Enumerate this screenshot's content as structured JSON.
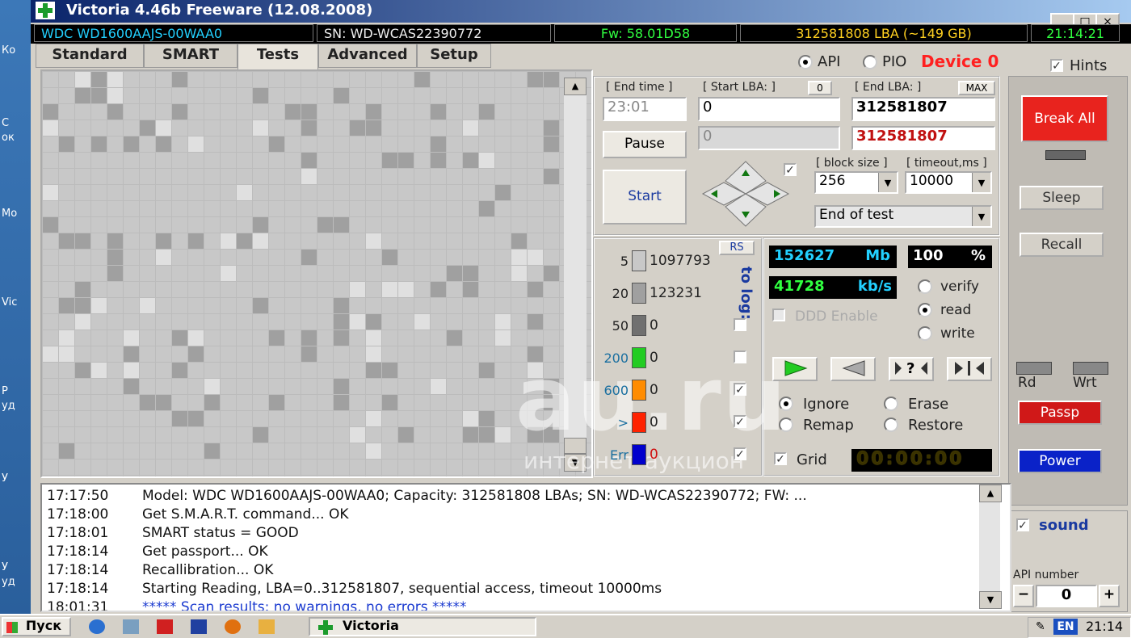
{
  "desktop_fragments": [
    "Ко",
    "С",
    "ок",
    "Мо",
    "Vic",
    "Р",
    "уд",
    "У",
    "У",
    "уд"
  ],
  "window": {
    "title": "Victoria 4.46b Freeware (12.08.2008)",
    "min": "_",
    "max": "□",
    "close": "×"
  },
  "infobar": {
    "model": "WDC WD1600AAJS-00WAA0",
    "serial": "SN: WD-WCAS22390772",
    "firmware": "Fw: 58.01D58",
    "lba": "312581808 LBA (~149 GB)",
    "clock": "21:14:21"
  },
  "tabs": [
    {
      "label": "Standard"
    },
    {
      "label": "SMART"
    },
    {
      "label": "Tests"
    },
    {
      "label": "Advanced"
    },
    {
      "label": "Setup"
    }
  ],
  "mode": {
    "api": "API",
    "pio": "PIO",
    "device": "Device 0",
    "hints": "Hints"
  },
  "test_controls": {
    "end_time_label": "[ End time ]",
    "end_time_value": "23:01",
    "start_lba_label": "[ Start LBA: ]",
    "start_lba_zero": "0",
    "start_lba_value": "0",
    "start_lba_current": "0",
    "end_lba_label": "[ End LBA: ]",
    "end_lba_max": "MAX",
    "end_lba_value": "312581807",
    "end_lba_current": "312581807",
    "pause": "Pause",
    "start": "Start",
    "block_size_label": "[ block size ]",
    "block_size_value": "256",
    "timeout_label": "[ timeout,ms ]",
    "timeout_value": "10000",
    "end_action": "End of test"
  },
  "stats": {
    "rs": "RS",
    "to_log": "to log:",
    "rows": [
      {
        "threshold": "5",
        "count": "1097793",
        "color": "#c8c8c8"
      },
      {
        "threshold": "20",
        "count": "123231",
        "color": "#a0a0a0"
      },
      {
        "threshold": "50",
        "count": "0",
        "color": "#707070"
      },
      {
        "threshold": "200",
        "count": "0",
        "color": "#22cc22"
      },
      {
        "threshold": "600",
        "count": "0",
        "color": "#ff8c00"
      },
      {
        "threshold": ">",
        "count": "0",
        "color": "#ff2200"
      },
      {
        "threshold": "Err",
        "count": "0",
        "color": "#0000cc"
      }
    ]
  },
  "progress": {
    "mb_value": "152627",
    "mb_unit": "Mb",
    "percent_value": "100",
    "percent_unit": "%",
    "speed_value": "41728",
    "speed_unit": "kb/s",
    "ddd": "DDD Enable",
    "verify": "verify",
    "read": "read",
    "write": "write",
    "nav_prev_unknown": "?",
    "ignore": "Ignore",
    "erase": "Erase",
    "remap": "Remap",
    "restore": "Restore",
    "grid": "Grid",
    "timer": "00:00:00"
  },
  "right_panel": {
    "break_all": "Break All",
    "sleep": "Sleep",
    "recall": "Recall",
    "rd": "Rd",
    "wrt": "Wrt",
    "passp": "Passp",
    "power": "Power",
    "sound": "sound",
    "api_number_label": "API number",
    "api_number_value": "0",
    "minus": "−",
    "plus": "+"
  },
  "log": [
    {
      "time": "17:17:50",
      "text": "Model: WDC WD1600AAJS-00WAA0; Capacity: 312581808 LBAs; SN: WD-WCAS22390772; FW: ..."
    },
    {
      "time": "17:18:00",
      "text": "Get S.M.A.R.T. command... OK"
    },
    {
      "time": "17:18:01",
      "text": "SMART status = GOOD"
    },
    {
      "time": "17:18:14",
      "text": "Get passport... OK"
    },
    {
      "time": "17:18:14",
      "text": "Recallibration... OK"
    },
    {
      "time": "17:18:14",
      "text": "Starting Reading, LBA=0..312581807, sequential access, timeout 10000ms"
    },
    {
      "time": "18:01:31",
      "text": "***** Scan results: no warnings, no errors *****"
    }
  ],
  "watermark": {
    "main": "au.ru",
    "sub": "интернет-аукцион"
  },
  "taskbar": {
    "start": "Пуск",
    "task": "Victoria",
    "lang": "EN",
    "clock": "21:14"
  },
  "colors": {
    "break_all": "#e8231e",
    "passp": "#d01818",
    "power": "#0a22c8",
    "lcd_cyan": "#22d0ff",
    "lcd_green": "#30ff40",
    "device_red": "#ff2020"
  }
}
